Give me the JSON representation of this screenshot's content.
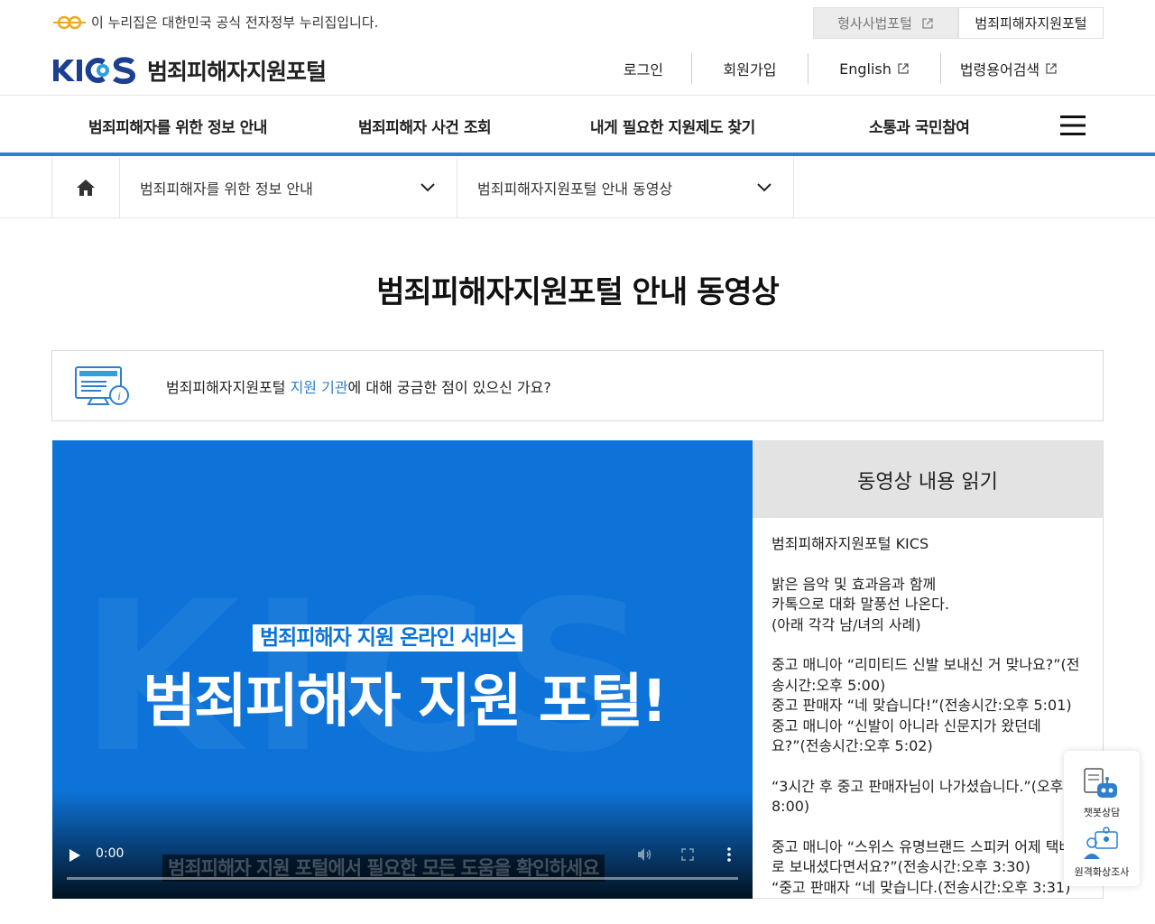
{
  "gov_banner": {
    "notice": "이 누리집은 대한민국 공식 전자정부 누리집입니다.",
    "portal_tabs": [
      "형사사법포털",
      "범죄피해자지원포털"
    ]
  },
  "header": {
    "logo_text": "범죄피해자지원포털",
    "util_nav": [
      "로그인",
      "회원가입",
      "English",
      "법령용어검색"
    ]
  },
  "gnb": {
    "items": [
      "범죄피해자를 위한 정보 안내",
      "범죄피해자 사건 조회",
      "내게 필요한 지원제도 찾기",
      "소통과 국민참여"
    ]
  },
  "breadcrumb": {
    "depth1": "범죄피해자를 위한 정보 안내",
    "depth2": "범죄피해자지원포털 안내 동영상"
  },
  "main": {
    "title": "범죄피해자지원포털 안내 동영상",
    "notice_pre": "범죄피해자지원포털 ",
    "notice_link": "지원 기관",
    "notice_post": "에 대해 궁금한 점이 있으신 가요?"
  },
  "video": {
    "bg_text": "KICS",
    "subtitle": "범죄피해자 지원 온라인 서비스",
    "headline": "범죄피해자 지원 포털!",
    "caption": "범죄피해자 지원 포털에서 필요한 모든 도움을 확인하세요",
    "time": "0:00",
    "progress": 0
  },
  "script": {
    "heading": "동영상 내용 읽기",
    "paragraphs": [
      "범죄피해자지원포털 KICS",
      "밝은 음악 및 효과음과 함께\n카톡으로 대화 말풍선 나온다.\n(아래 각각 남/녀의 사례)",
      "중고 매니아 “리미티드 신발 보내신 거 맞나요?”(전송시간:오후 5:00)\n중고 판매자 “네 맞습니다!”(전송시간:오후 5:01)\n중고 매니아 “신발이 아니라 신문지가 왔던데요?”(전송시간:오후 5:02)",
      "“3시간 후 중고 판매자님이 나가셨습니다.”(오후 8:00)",
      "중고 매니아 “스위스 유명브랜드 스피커 어제 택배로 보내셨다면서요?”(전송시간:오후 3:30)\n“중고 판매자 “네 맞습니다.(전송시간:오후 3:31)”"
    ]
  },
  "quick_menu": {
    "items": [
      "챗봇상담",
      "원격화상조사"
    ]
  },
  "colors": {
    "accent": "#2f7fd1",
    "video_bg": "#0d73d8",
    "logo_navy": "#1b3f91"
  }
}
